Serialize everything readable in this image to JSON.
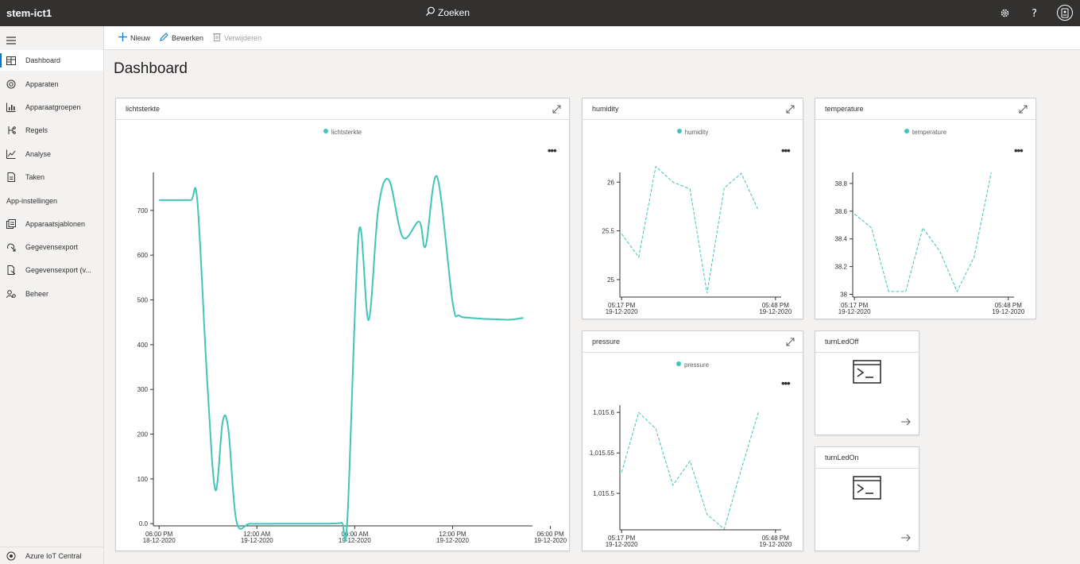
{
  "app": {
    "title": "stem-ict1",
    "search_label": "Zoeken"
  },
  "topbar": {
    "icons": [
      "settings-icon",
      "help-icon",
      "user-avatar-icon"
    ]
  },
  "sidebar": {
    "items": [
      {
        "label": "Dashboard",
        "icon": "dashboard-icon",
        "active": true
      },
      {
        "label": "Apparaten",
        "icon": "devices-icon"
      },
      {
        "label": "Apparaatgroepen",
        "icon": "device-groups-icon"
      },
      {
        "label": "Regels",
        "icon": "rules-icon"
      },
      {
        "label": "Analyse",
        "icon": "analytics-icon"
      },
      {
        "label": "Taken",
        "icon": "jobs-icon"
      }
    ],
    "section_label": "App-instellingen",
    "settings_items": [
      {
        "label": "Apparaatsjablonen",
        "icon": "templates-icon"
      },
      {
        "label": "Gegevensexport",
        "icon": "export-icon"
      },
      {
        "label": "Gegevensexport (v...",
        "icon": "export-legacy-icon"
      },
      {
        "label": "Beheer",
        "icon": "admin-icon"
      }
    ],
    "bottom_label": "Azure IoT Central"
  },
  "toolbar": {
    "new_label": "Nieuw",
    "edit_label": "Bewerken",
    "delete_label": "Verwijderen"
  },
  "page": {
    "title": "Dashboard"
  },
  "tiles": {
    "lichtsterkte": {
      "title": "lichtsterkte"
    },
    "humidity": {
      "title": "humidity"
    },
    "temperature": {
      "title": "temperature"
    },
    "pressure": {
      "title": "pressure"
    },
    "turnLedOff": {
      "title": "turnLedOff"
    },
    "turnLedOn": {
      "title": "turnLedOn"
    }
  },
  "chart_data": [
    {
      "id": "lichtsterkte",
      "type": "line",
      "curve": "smooth",
      "dashed": false,
      "color": "#40c5ba",
      "series": [
        {
          "name": "lichtsterkte",
          "x": [
            0.0,
            1.05,
            1.95,
            2.35,
            2.95,
            3.45,
            3.9,
            4.25,
            4.75,
            5.6,
            7.2,
            9.0,
            10.4,
            11.2,
            11.55,
            12.25,
            12.85,
            13.45,
            14.1,
            14.95,
            15.95,
            16.35,
            17.05,
            18.0,
            18.4,
            19.1,
            19.8,
            20.45,
            21.05,
            21.65,
            22.35
          ],
          "y": [
            723,
            723,
            723,
            720,
            320,
            75,
            228,
            210,
            5,
            0,
            0,
            0,
            0,
            2,
            10,
            650,
            455,
            705,
            768,
            640,
            675,
            620,
            775,
            495,
            465,
            460,
            458,
            457,
            456,
            456,
            460
          ]
        }
      ],
      "xlim": [
        -0.35,
        22.9
      ],
      "ylim": [
        -5,
        785
      ],
      "yticks": [
        0,
        100,
        200,
        300,
        400,
        500,
        600,
        700
      ],
      "ytick_labels": [
        "0.0",
        "100",
        "200",
        "300",
        "400",
        "500",
        "600",
        "700"
      ],
      "xticks": [
        0.0,
        6.0,
        12.0,
        18.0,
        24.0
      ],
      "xtick_labels": [
        [
          "06:00 PM",
          "18-12-2020"
        ],
        [
          "12:00 AM",
          "19-12-2020"
        ],
        [
          "06:00 AM",
          "19-12-2020"
        ],
        [
          "12:00 PM",
          "19-12-2020"
        ],
        [
          "06:00 PM",
          "19-12-2020"
        ]
      ]
    },
    {
      "id": "humidity",
      "type": "line",
      "curve": "linear",
      "dashed": true,
      "color": "#40c5ba",
      "series": [
        {
          "name": "humidity",
          "x": [
            0,
            3,
            6,
            9,
            12,
            15,
            18,
            21,
            24,
            27
          ],
          "y": [
            25.47,
            25.23,
            26.16,
            26.0,
            25.93,
            24.86,
            25.94,
            26.09,
            25.71,
            null
          ]
        }
      ],
      "xlim": [
        -0.3,
        28
      ],
      "ylim": [
        24.82,
        26.1
      ],
      "yticks": [
        25.0,
        25.5,
        26.0
      ],
      "ytick_labels": [
        "25",
        "25.5",
        "26"
      ],
      "xticks": [
        0,
        27
      ],
      "xtick_labels": [
        [
          "05:17 PM",
          "19-12-2020"
        ],
        [
          "05:48 PM",
          "19-12-2020"
        ]
      ]
    },
    {
      "id": "temperature",
      "type": "line",
      "curve": "linear",
      "dashed": true,
      "color": "#40c5ba",
      "series": [
        {
          "name": "temperature",
          "x": [
            0,
            3,
            6,
            9,
            12,
            15,
            18,
            21,
            24,
            27
          ],
          "y": [
            38.58,
            38.48,
            38.02,
            38.02,
            38.48,
            38.31,
            38.02,
            38.27,
            38.88,
            null
          ]
        }
      ],
      "xlim": [
        -0.3,
        28
      ],
      "ylim": [
        37.98,
        38.88
      ],
      "yticks": [
        38.0,
        38.2,
        38.4,
        38.6,
        38.8
      ],
      "ytick_labels": [
        "38",
        "38.2",
        "38.4",
        "38.6",
        "38.8"
      ],
      "xticks": [
        0,
        27
      ],
      "xtick_labels": [
        [
          "05:17 PM",
          "19-12-2020"
        ],
        [
          "05:48 PM",
          "19-12-2020"
        ]
      ]
    },
    {
      "id": "pressure",
      "type": "line",
      "curve": "linear",
      "dashed": true,
      "color": "#40c5ba",
      "series": [
        {
          "name": "pressure",
          "x": [
            0,
            3,
            6,
            9,
            12,
            15,
            18,
            21,
            24,
            27
          ],
          "y": [
            1015.526,
            1015.6,
            1015.58,
            1015.51,
            1015.54,
            1015.474,
            1015.456,
            1015.53,
            1015.6,
            null
          ]
        }
      ],
      "xlim": [
        -0.3,
        28
      ],
      "ylim": [
        1015.455,
        1015.609
      ],
      "yticks": [
        1015.5,
        1015.55,
        1015.6
      ],
      "ytick_labels": [
        "1,015.5",
        "1,015.55",
        "1,015.6"
      ],
      "xticks": [
        0,
        27
      ],
      "xtick_labels": [
        [
          "05:17 PM",
          "19-12-2020"
        ],
        [
          "05:48 PM",
          "19-12-2020"
        ]
      ]
    }
  ]
}
